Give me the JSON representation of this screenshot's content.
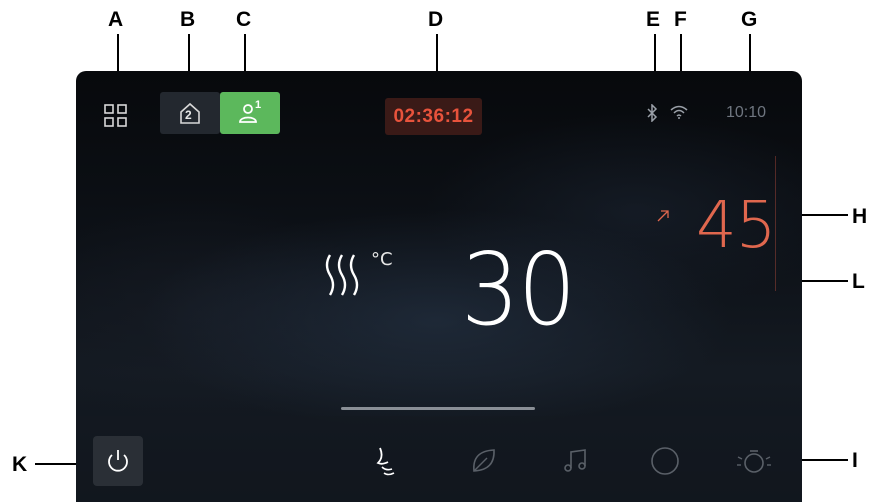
{
  "callouts": {
    "a": "A",
    "b": "B",
    "c": "C",
    "d": "D",
    "e": "E",
    "f": "F",
    "g": "G",
    "h": "H",
    "i": "I",
    "k": "K",
    "l": "L"
  },
  "status": {
    "zone_number": "2",
    "profile_number": "1",
    "timer": "02:36:12",
    "clock": "10:10"
  },
  "temperature": {
    "current": "30",
    "unit": "°C",
    "target": "45",
    "trend_icon": "arrow-up-right-icon"
  },
  "bottom_bar": {
    "icons": [
      "power-icon",
      "massage-jet-icon",
      "leaf-icon",
      "music-note-icon",
      "circle-icon",
      "light-icon"
    ]
  },
  "colors": {
    "profile_active": "#5cb85c",
    "timer_text": "#e8533c",
    "timer_bg": "#3a1a17",
    "target_temp": "#e0674e",
    "main_text": "#ffffff"
  }
}
